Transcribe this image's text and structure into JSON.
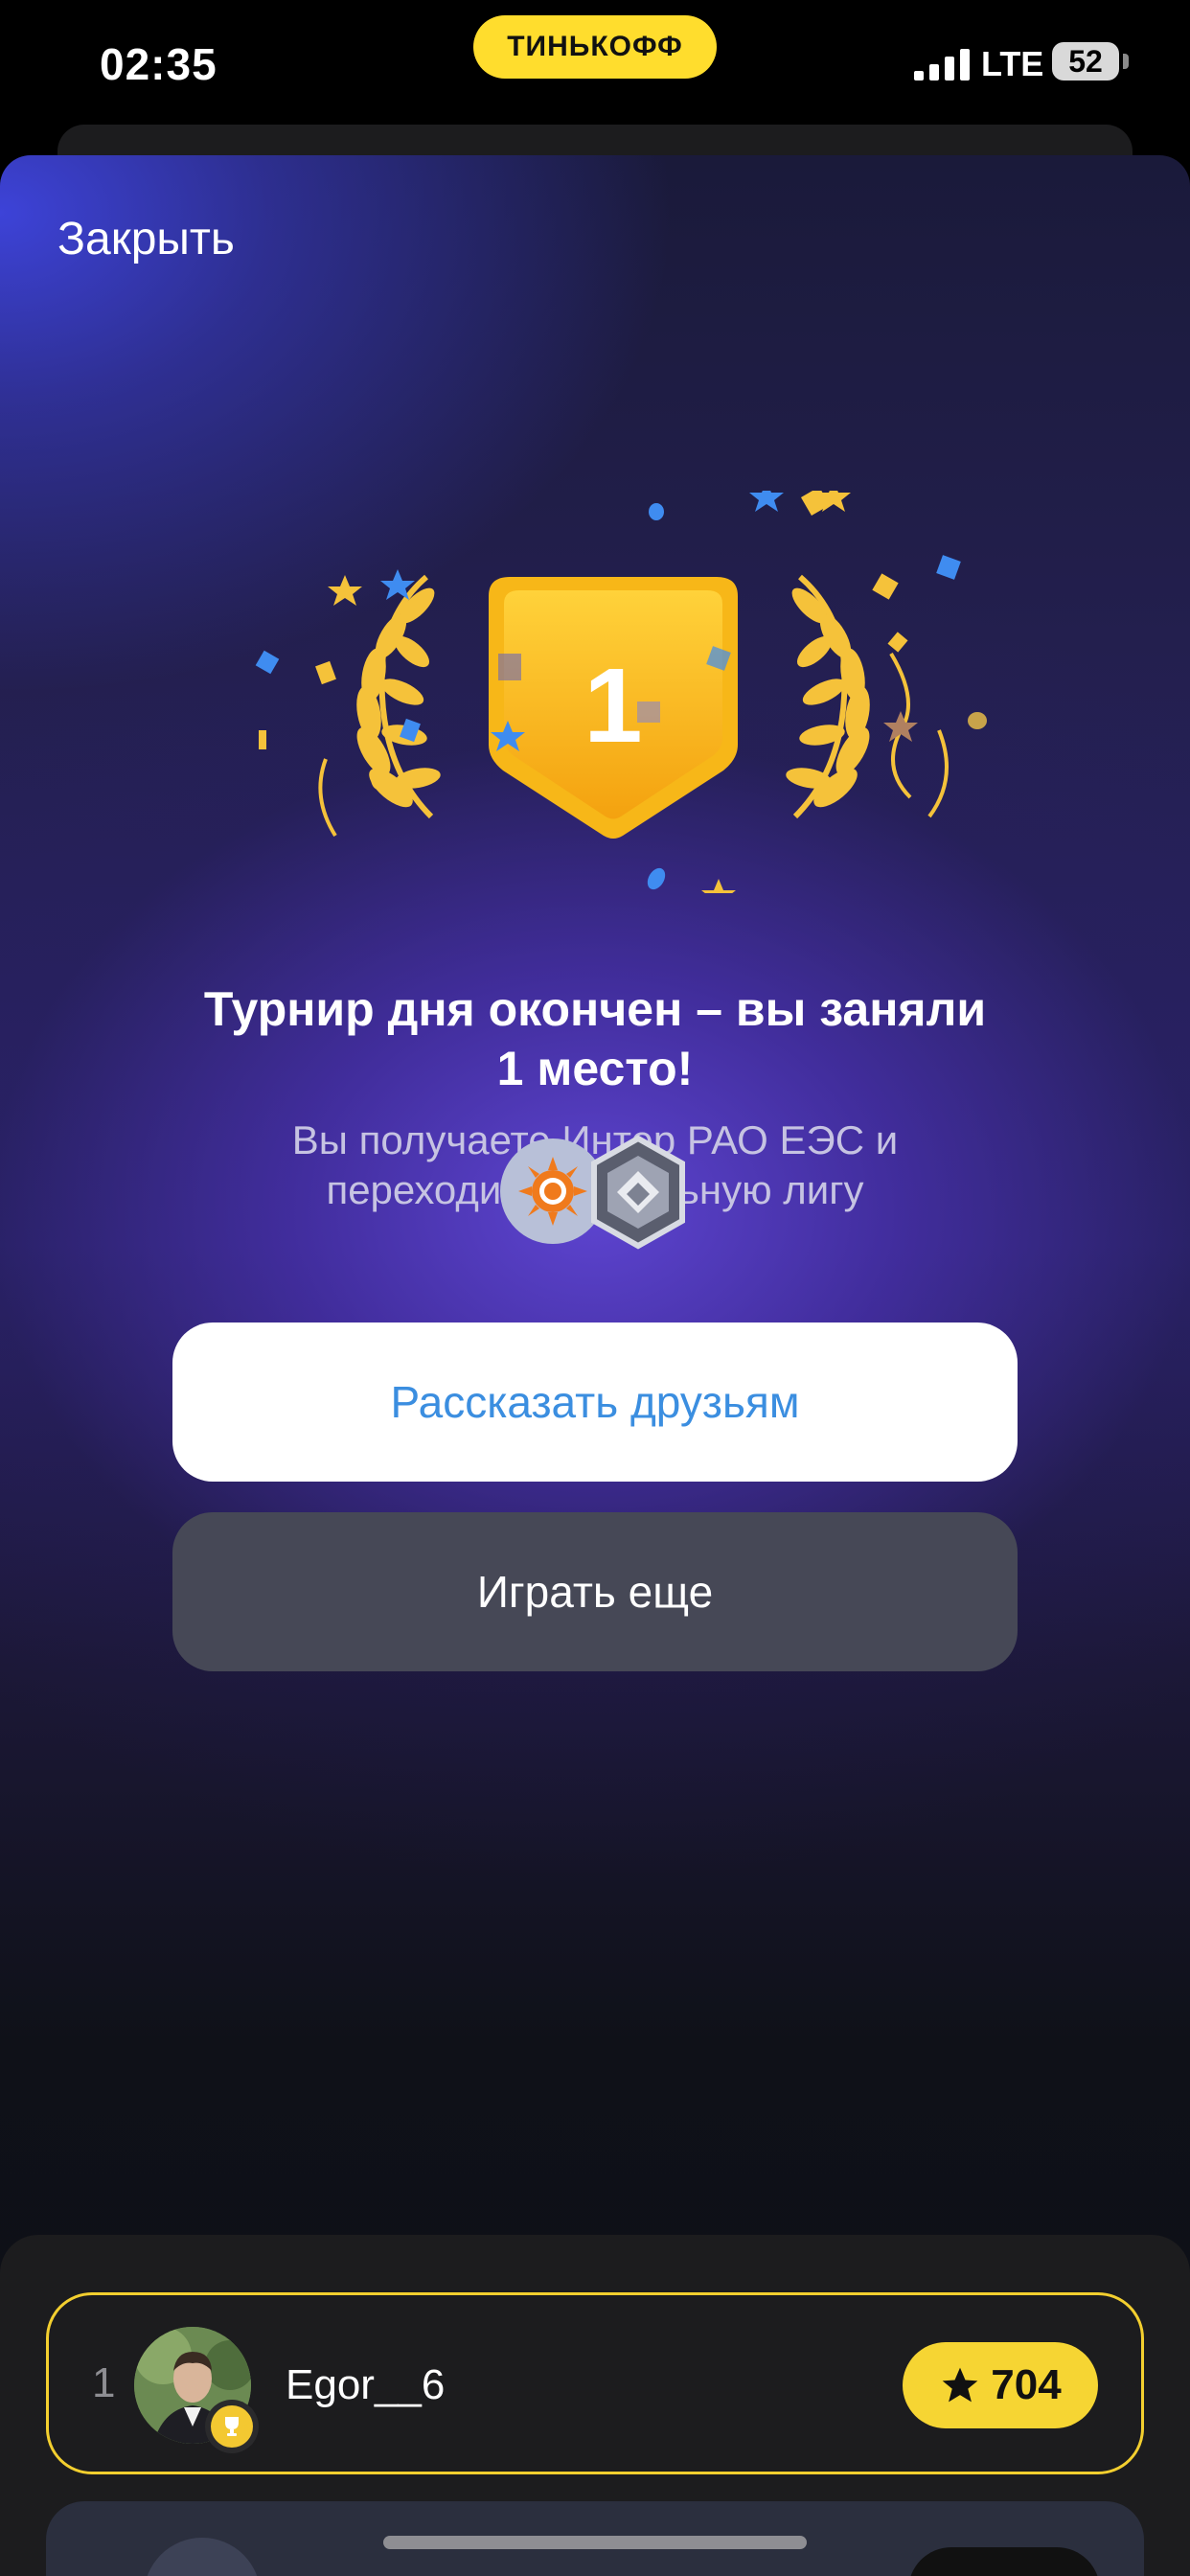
{
  "status_bar": {
    "time": "02:35",
    "carrier_brand": "ТИНЬКОФФ",
    "network": "LTE",
    "battery": "52"
  },
  "header": {
    "close_label": "Закрыть"
  },
  "result": {
    "place_number": "1",
    "headline_line1": "Турнир дня окончен – вы заняли",
    "headline_line2": "1 место!",
    "subtext_line1": "Вы получаете Интер РАО ЕЭС и",
    "subtext_line2": "переходите в Стальную лигу"
  },
  "actions": {
    "share_label": "Рассказать друзьям",
    "play_again_label": "Играть еще"
  },
  "leaderboard": {
    "rows": [
      {
        "rank": "1",
        "username": "Egor__6",
        "score": "704"
      }
    ]
  },
  "icons": {
    "signal": "signal-bars-icon",
    "reward": "inter-rao-logo-icon",
    "league": "steel-league-icon",
    "cup": "trophy-cup-icon",
    "star": "star-icon"
  },
  "colors": {
    "accent_yellow": "#ffdd2d",
    "link_blue": "#3b8ee0",
    "secondary_button": "#464856",
    "highlight_border": "#f3cf2f"
  }
}
